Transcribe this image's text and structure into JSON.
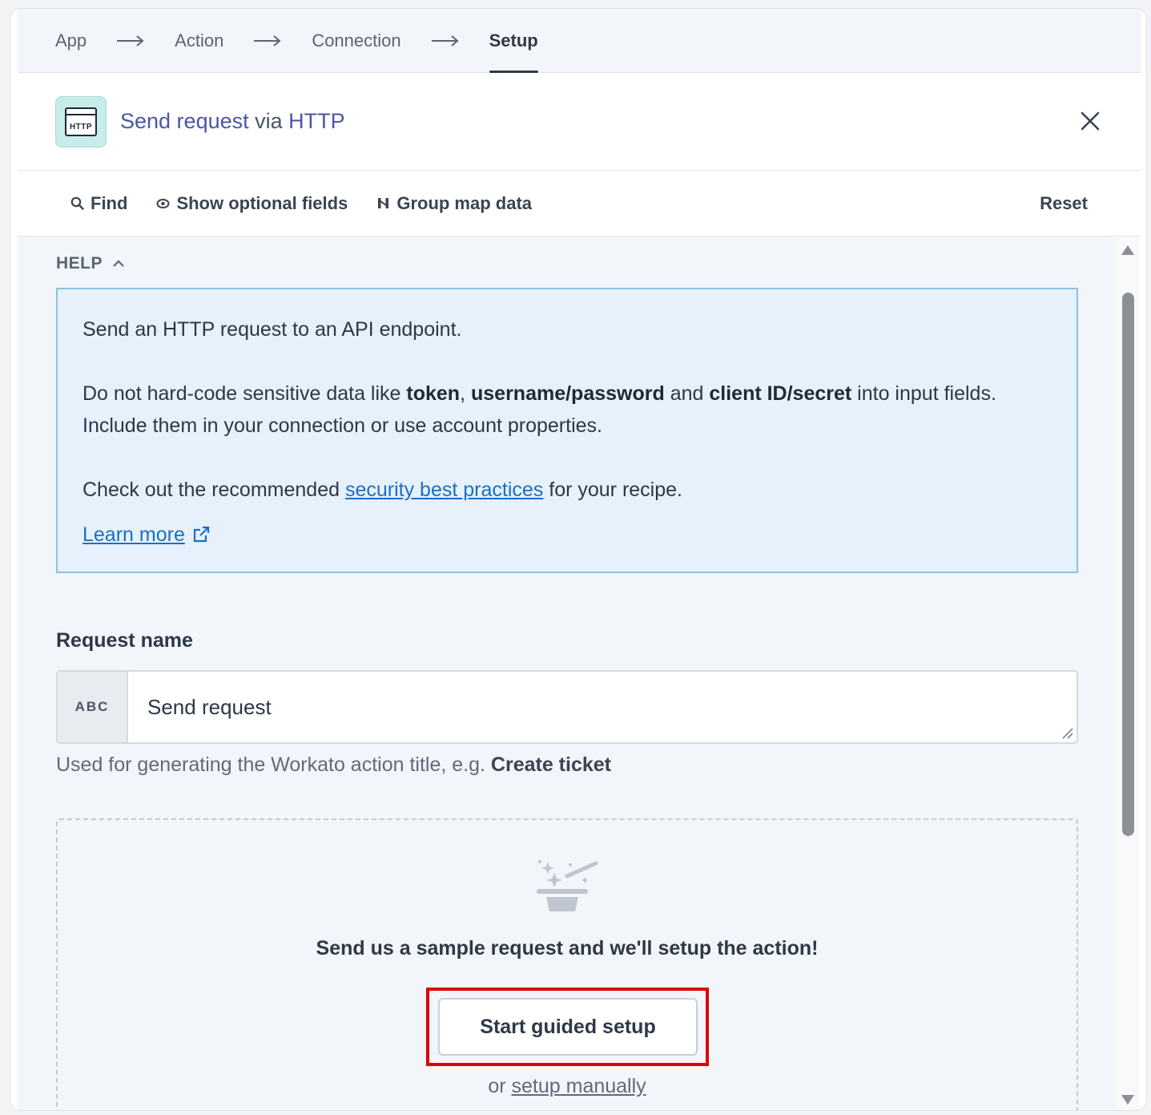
{
  "breadcrumb": {
    "steps": [
      "App",
      "Action",
      "Connection",
      "Setup"
    ],
    "active_index": 3
  },
  "header": {
    "app_icon_text": "HTTP",
    "action_name": "Send request",
    "via_word": "via",
    "app_name": "HTTP",
    "close_icon": "close-icon"
  },
  "toolbar": {
    "find_label": "Find",
    "optional_label": "Show optional fields",
    "group_label": "Group map data",
    "reset_label": "Reset"
  },
  "help": {
    "heading": "HELP",
    "line1": "Send an HTTP request to an API endpoint.",
    "p2_a": "Do not hard-code sensitive data like ",
    "p2_token": "token",
    "p2_b": ", ",
    "p2_userpass": "username/password",
    "p2_c": " and ",
    "p2_client": "client ID/secret",
    "p2_d": " into input fields.",
    "p2_e": "Include them in your connection or use account properties.",
    "p3_a": "Check out the recommended ",
    "p3_link": "security best practices",
    "p3_b": " for your recipe.",
    "learn_more": "Learn more"
  },
  "request_name": {
    "label": "Request name",
    "type_badge": "ABC",
    "value": "Send request",
    "hint_prefix": "Used for generating the Workato action title, e.g. ",
    "hint_example": "Create ticket"
  },
  "guided": {
    "title": "Send us a sample request and we'll setup the action!",
    "button_label": "Start guided setup",
    "or_text": "or ",
    "manual_link": "setup manually"
  },
  "colors": {
    "link": "#1a6fc4",
    "highlight": "#e00000",
    "help_bg": "#e6f1fb",
    "app_tile": "#c8ecea"
  }
}
